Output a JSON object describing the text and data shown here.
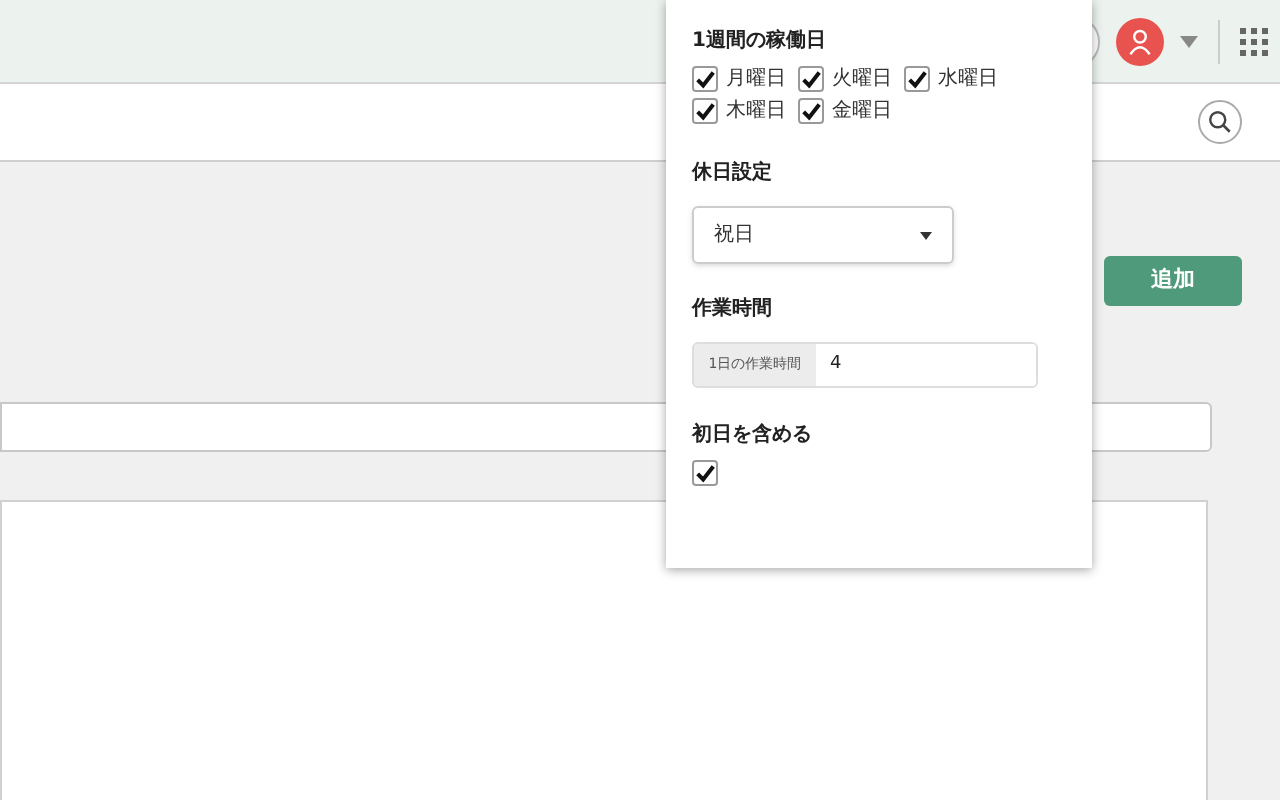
{
  "add_button": {
    "label": "追加"
  },
  "popup": {
    "workdays": {
      "title": "1週間の稼働日",
      "days": [
        {
          "label": "月曜日",
          "checked": true
        },
        {
          "label": "火曜日",
          "checked": true
        },
        {
          "label": "水曜日",
          "checked": true
        },
        {
          "label": "木曜日",
          "checked": true
        },
        {
          "label": "金曜日",
          "checked": true
        }
      ]
    },
    "holiday": {
      "title": "休日設定",
      "value": "祝日"
    },
    "hours": {
      "title": "作業時間",
      "addon": "1日の作業時間",
      "value": "4"
    },
    "include_first": {
      "title": "初日を含める",
      "checked": true
    }
  }
}
